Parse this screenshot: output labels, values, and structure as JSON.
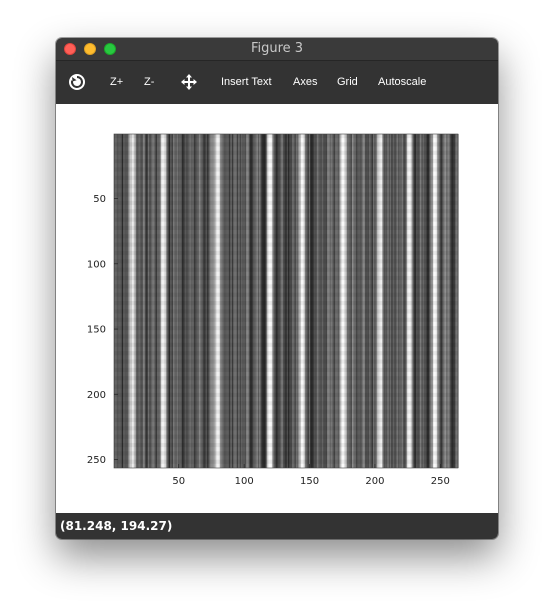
{
  "window": {
    "title": "Figure 3",
    "traffic_colors": {
      "close": "#ff5f57",
      "minimize": "#febc2e",
      "maximize": "#28c840"
    }
  },
  "toolbar": {
    "reset_icon": "rotate-reset-icon",
    "zoom_in_label": "Z+",
    "zoom_out_label": "Z-",
    "pan_icon": "move-arrows-icon",
    "insert_text_label": "Insert Text",
    "axes_label": "Axes",
    "grid_label": "Grid",
    "autoscale_label": "Autoscale"
  },
  "chart_data": {
    "type": "heatmap",
    "colormap": "gray",
    "title": "",
    "xlabel": "",
    "ylabel": "",
    "xlim": [
      0.5,
      263.5
    ],
    "ylim": [
      256.5,
      0.5
    ],
    "y_axis_direction": "reversed (top to bottom)",
    "xticks": [
      50,
      100,
      150,
      200,
      250
    ],
    "xtick_labels": [
      "50",
      "100",
      "150",
      "200",
      "250"
    ],
    "yticks": [
      50,
      100,
      150,
      200,
      250
    ],
    "ytick_labels": [
      "50",
      "100",
      "150",
      "200",
      "250"
    ],
    "grid": false,
    "legend": false,
    "description_values": {
      "pattern": "vertical stripes, intensity varies mainly with column index",
      "bright_columns": [
        14,
        37,
        79,
        119,
        143,
        175,
        203,
        225,
        245
      ],
      "value_range": [
        0,
        1
      ]
    }
  },
  "status": {
    "coordinates": "(81.248, 194.27)"
  }
}
